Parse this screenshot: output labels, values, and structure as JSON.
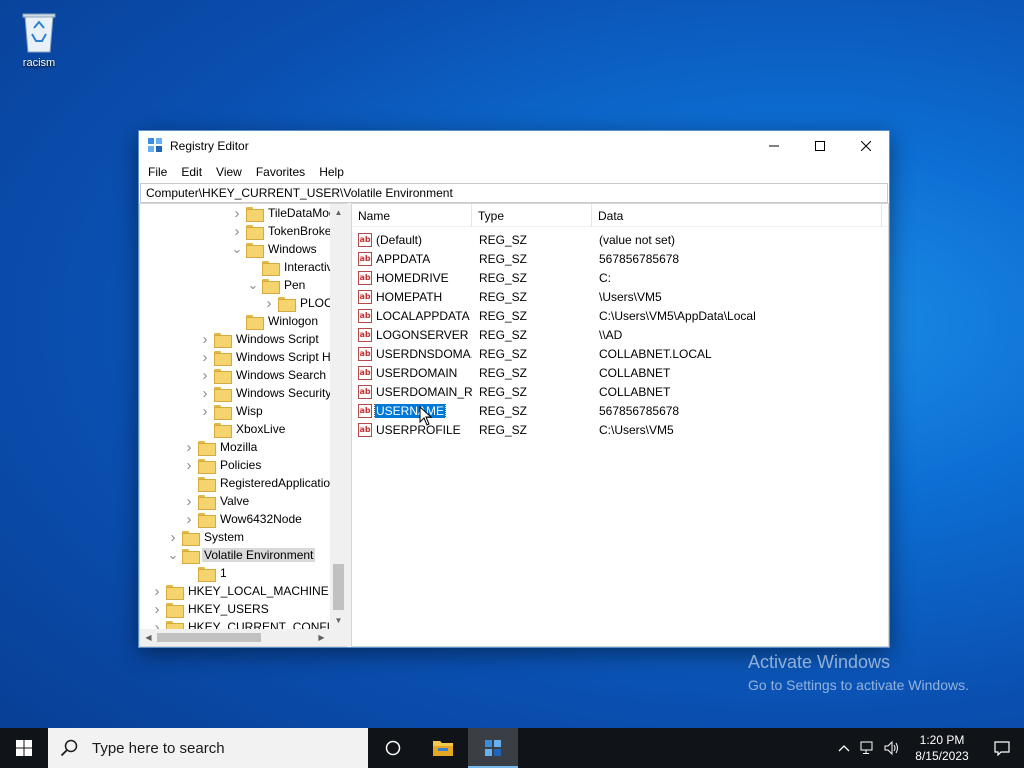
{
  "desktop": {
    "icons": [
      {
        "label": "racism",
        "icon": "recycle-bin-icon"
      }
    ],
    "watermark": {
      "line1": "Activate Windows",
      "line2": "Go to Settings to activate Windows."
    }
  },
  "window": {
    "title": "Registry Editor",
    "menu": [
      "File",
      "Edit",
      "View",
      "Favorites",
      "Help"
    ],
    "address": "Computer\\HKEY_CURRENT_USER\\Volatile Environment",
    "tree": [
      {
        "label": "TileDataMod",
        "indent": 5,
        "expander": "collapsed"
      },
      {
        "label": "TokenBroker",
        "indent": 5,
        "expander": "collapsed"
      },
      {
        "label": "Windows",
        "indent": 5,
        "expander": "expanded"
      },
      {
        "label": "Interactiv",
        "indent": 6,
        "expander": "none"
      },
      {
        "label": "Pen",
        "indent": 6,
        "expander": "expanded"
      },
      {
        "label": "PLOC",
        "indent": 7,
        "expander": "collapsed"
      },
      {
        "label": "Winlogon",
        "indent": 5,
        "expander": "none"
      },
      {
        "label": "Windows Script",
        "indent": 3,
        "expander": "collapsed"
      },
      {
        "label": "Windows Script Ho",
        "indent": 3,
        "expander": "collapsed"
      },
      {
        "label": "Windows Search",
        "indent": 3,
        "expander": "collapsed"
      },
      {
        "label": "Windows Security",
        "indent": 3,
        "expander": "collapsed"
      },
      {
        "label": "Wisp",
        "indent": 3,
        "expander": "collapsed"
      },
      {
        "label": "XboxLive",
        "indent": 3,
        "expander": "none"
      },
      {
        "label": "Mozilla",
        "indent": 2,
        "expander": "collapsed"
      },
      {
        "label": "Policies",
        "indent": 2,
        "expander": "collapsed"
      },
      {
        "label": "RegisteredApplication",
        "indent": 2,
        "expander": "none"
      },
      {
        "label": "Valve",
        "indent": 2,
        "expander": "collapsed"
      },
      {
        "label": "Wow6432Node",
        "indent": 2,
        "expander": "collapsed"
      },
      {
        "label": "System",
        "indent": 1,
        "expander": "collapsed"
      },
      {
        "label": "Volatile Environment",
        "indent": 1,
        "expander": "expanded",
        "selected": true
      },
      {
        "label": "1",
        "indent": 2,
        "expander": "none"
      },
      {
        "label": "HKEY_LOCAL_MACHINE",
        "indent": 0,
        "expander": "collapsed"
      },
      {
        "label": "HKEY_USERS",
        "indent": 0,
        "expander": "collapsed"
      },
      {
        "label": "HKEY_CURRENT_CONFIG",
        "indent": 0,
        "expander": "collapsed"
      }
    ],
    "columns": {
      "name": "Name",
      "type": "Type",
      "data": "Data"
    },
    "values": [
      {
        "name": "(Default)",
        "type": "REG_SZ",
        "data": "(value not set)"
      },
      {
        "name": "APPDATA",
        "type": "REG_SZ",
        "data": "567856785678"
      },
      {
        "name": "HOMEDRIVE",
        "type": "REG_SZ",
        "data": "C:"
      },
      {
        "name": "HOMEPATH",
        "type": "REG_SZ",
        "data": "\\Users\\VM5"
      },
      {
        "name": "LOCALAPPDATA",
        "type": "REG_SZ",
        "data": "C:\\Users\\VM5\\AppData\\Local"
      },
      {
        "name": "LOGONSERVER",
        "type": "REG_SZ",
        "data": "\\\\AD"
      },
      {
        "name": "USERDNSDOMA...",
        "type": "REG_SZ",
        "data": "COLLABNET.LOCAL"
      },
      {
        "name": "USERDOMAIN",
        "type": "REG_SZ",
        "data": "COLLABNET"
      },
      {
        "name": "USERDOMAIN_R...",
        "type": "REG_SZ",
        "data": "COLLABNET"
      },
      {
        "name": "USERNAME",
        "type": "REG_SZ",
        "data": "567856785678",
        "selected": true
      },
      {
        "name": "USERPROFILE",
        "type": "REG_SZ",
        "data": "C:\\Users\\VM5"
      }
    ]
  },
  "taskbar": {
    "search_placeholder": "Type here to search",
    "clock_time": "1:20 PM",
    "clock_date": "8/15/2023"
  },
  "colors": {
    "accent": "#0078d7",
    "taskbar": "#101418"
  }
}
